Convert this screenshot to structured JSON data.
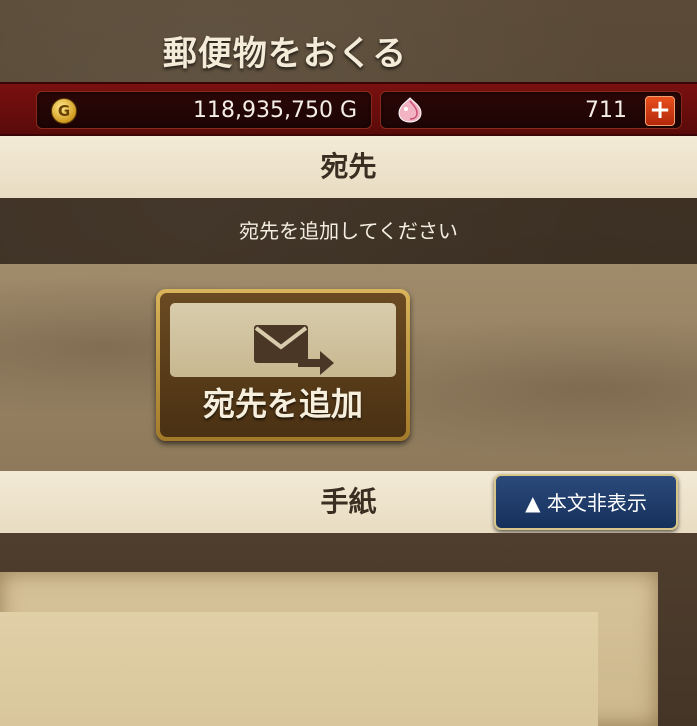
{
  "title": "郵便物をおくる",
  "currency": {
    "gold_icon": "coin-icon",
    "gold_value": "118,935,750 G",
    "gem_icon": "gem-icon",
    "gem_value": "711",
    "add_gems_label": "+"
  },
  "destination": {
    "header": "宛先",
    "prompt": "宛先を追加してください",
    "add_button_label": "宛先を追加",
    "add_button_icon": "mail-send-icon"
  },
  "letter": {
    "header": "手紙",
    "hide_body_button": "▲ 本文非表示"
  },
  "colors": {
    "header_bar": "#6a0d0d",
    "button_gold": "#c79d45",
    "hide_button_blue": "#1f3d6b"
  }
}
